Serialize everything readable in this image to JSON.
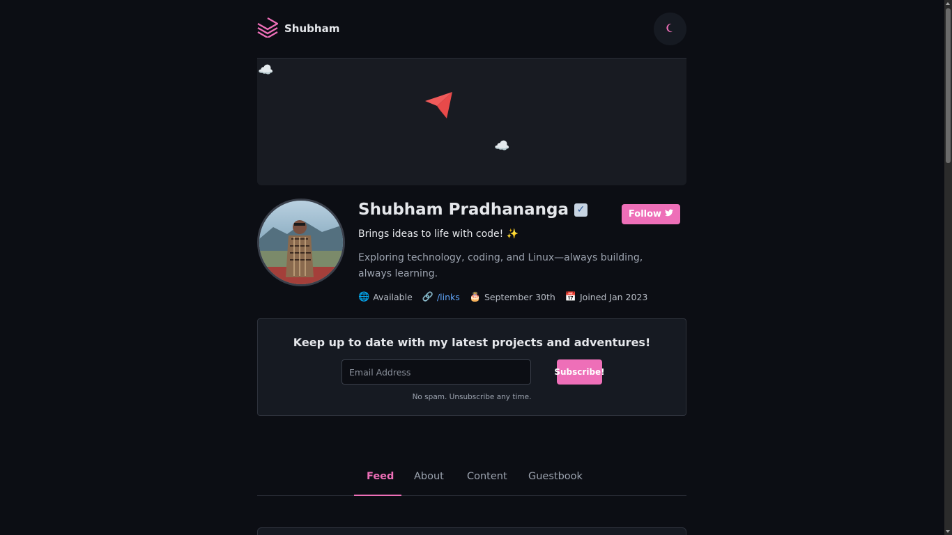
{
  "header": {
    "brand_name": "Shubham",
    "theme_toggle_icon": "moon-icon"
  },
  "profile": {
    "name": "Shubham Pradhananga",
    "verified_icon": "check-box-icon",
    "follow_label": "Follow",
    "tagline": "Brings ideas to life with code! ✨",
    "bio": "Exploring technology, coding, and Linux—always building, always learning.",
    "meta": {
      "status": "Available",
      "links": "/links",
      "birthday": "September 30th",
      "joined": "Joined Jan 2023"
    }
  },
  "subscribe": {
    "title": "Keep up to date with my latest projects and adventures!",
    "email_placeholder": "Email Address",
    "button_label": "Subscribe!",
    "note": "No spam. Unsubscribe any time."
  },
  "tabs": [
    {
      "label": "Feed",
      "active": true
    },
    {
      "label": "About",
      "active": false
    },
    {
      "label": "Content",
      "active": false
    },
    {
      "label": "Guestbook",
      "active": false
    }
  ],
  "colors": {
    "accent": "#ee6fb8",
    "background": "#0c0e14",
    "card": "#161a22",
    "link": "#60a5fa",
    "plane": "#f05a5a"
  }
}
